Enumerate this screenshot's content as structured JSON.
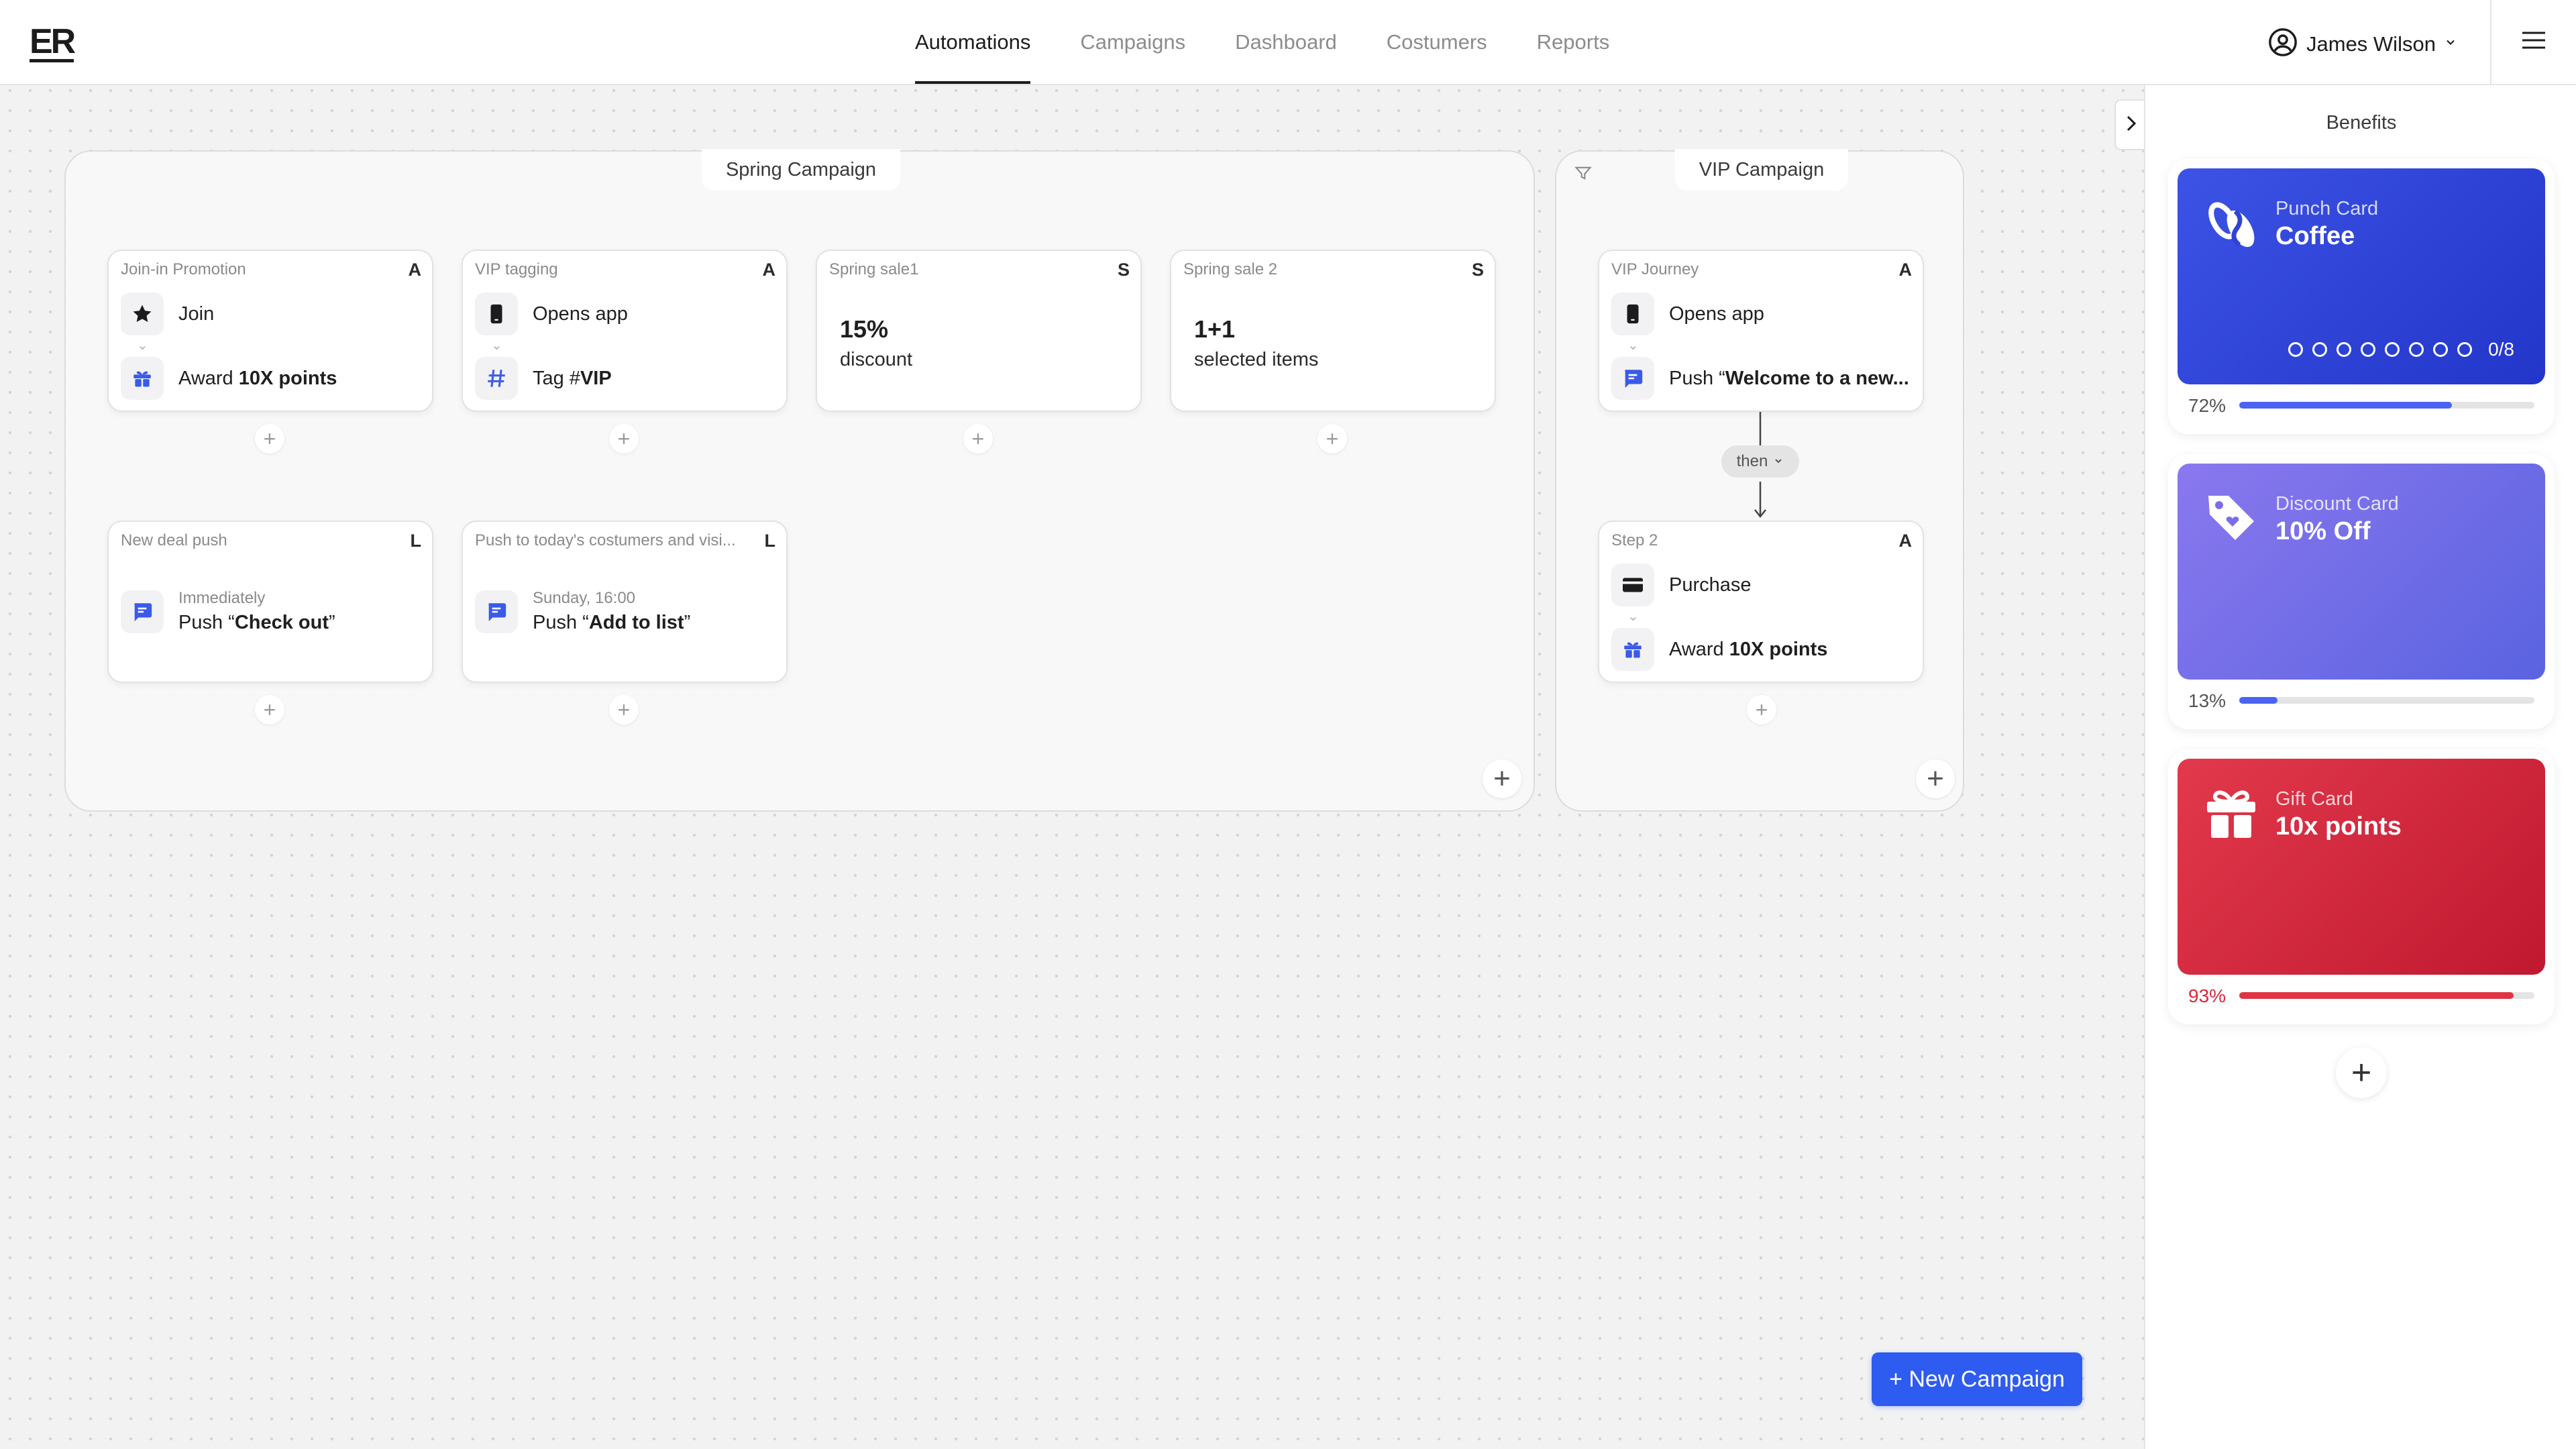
{
  "app": {
    "logo": "ER"
  },
  "nav": {
    "items": [
      "Automations",
      "Campaigns",
      "Dashboard",
      "Costumers",
      "Reports"
    ],
    "active": "Automations"
  },
  "user": {
    "name": "James Wilson"
  },
  "spring_campaign": {
    "title": "Spring Campaign",
    "cards": [
      {
        "title": "Join-in Promotion",
        "badge": "A",
        "row1": "Join",
        "row2_prefix": "Award ",
        "row2_bold": "10X points"
      },
      {
        "title": "VIP tagging",
        "badge": "A",
        "row1": "Opens app",
        "row2_prefix": "Tag #",
        "row2_bold": "VIP"
      },
      {
        "title": "Spring sale1",
        "badge": "S",
        "value": "15%",
        "subtitle": "discount"
      },
      {
        "title": "Spring sale 2",
        "badge": "S",
        "value": "1+1",
        "subtitle": "selected items"
      },
      {
        "title": "New deal push",
        "badge": "L",
        "when": "Immediately",
        "push_prefix": "Push “",
        "push_bold": "Check out",
        "push_suffix": "”"
      },
      {
        "title": "Push to today's costumers and visi...",
        "badge": "L",
        "when": "Sunday, 16:00",
        "push_prefix": "Push “",
        "push_bold": "Add to list",
        "push_suffix": "”"
      }
    ]
  },
  "vip_campaign": {
    "title": "VIP Campaign",
    "connector_label": "then",
    "cards": [
      {
        "title": "VIP Journey",
        "badge": "A",
        "row1": "Opens app",
        "row2_prefix": "Push “",
        "row2_bold": "Welcome to a new..."
      },
      {
        "title": "Step 2",
        "badge": "A",
        "row1": "Purchase",
        "row2_prefix": "Award ",
        "row2_bold": "10X points"
      }
    ]
  },
  "sidebar": {
    "title": "Benefits",
    "cards": [
      {
        "type": "Punch Card",
        "name": "Coffee",
        "punch_count": "0/8",
        "percent_label": "72%",
        "progress": 0.72,
        "color_from": "#3d53e6",
        "color_to": "#2236c9",
        "bar_color": "#4a63f0",
        "label_color": "#555555"
      },
      {
        "type": "Discount Card",
        "name": "10% Off",
        "percent_label": "13%",
        "progress": 0.13,
        "color_from": "#8a78ee",
        "color_to": "#5a63e0",
        "bar_color": "#4a63f0",
        "label_color": "#555555"
      },
      {
        "type": "Gift Card",
        "name": "10x points",
        "percent_label": "93%",
        "progress": 0.93,
        "color_from": "#e2394c",
        "color_to": "#c0182f",
        "bar_color": "#e03444",
        "label_color": "#d8283a"
      }
    ]
  },
  "actions": {
    "new_campaign": "+ New Campaign"
  },
  "icons": [
    "star-icon",
    "gift-icon",
    "phone-icon",
    "hash-icon",
    "chat-icon",
    "card-icon",
    "user-circle-icon",
    "chevron-down-icon",
    "menu-icon",
    "chevron-right-icon",
    "filter-icon",
    "coffee-icon",
    "tag-icon",
    "plus-icon"
  ]
}
